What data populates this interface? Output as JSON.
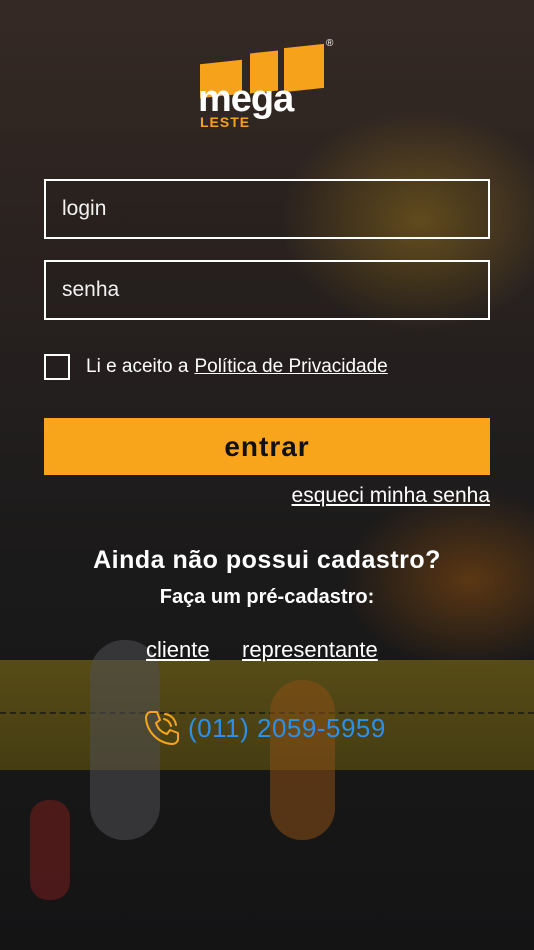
{
  "brand": {
    "logo_main": "mega",
    "logo_sub": "LESTE",
    "registered_mark": "®",
    "accent_color": "#f9a51c"
  },
  "form": {
    "login_placeholder": "login",
    "password_placeholder": "senha",
    "terms_text": "Li e aceito a",
    "terms_link": "Política de Privacidade",
    "submit_label": "entrar",
    "forgot_link": "esqueci minha senha"
  },
  "signup": {
    "title": "Ainda não possui cadastro?",
    "subtitle": "Faça um pré-cadastro:",
    "options": [
      "cliente",
      "representante"
    ]
  },
  "contact": {
    "icon": "phone-icon",
    "phone": "(011) 2059-5959",
    "phone_color": "#2e8fe8"
  }
}
